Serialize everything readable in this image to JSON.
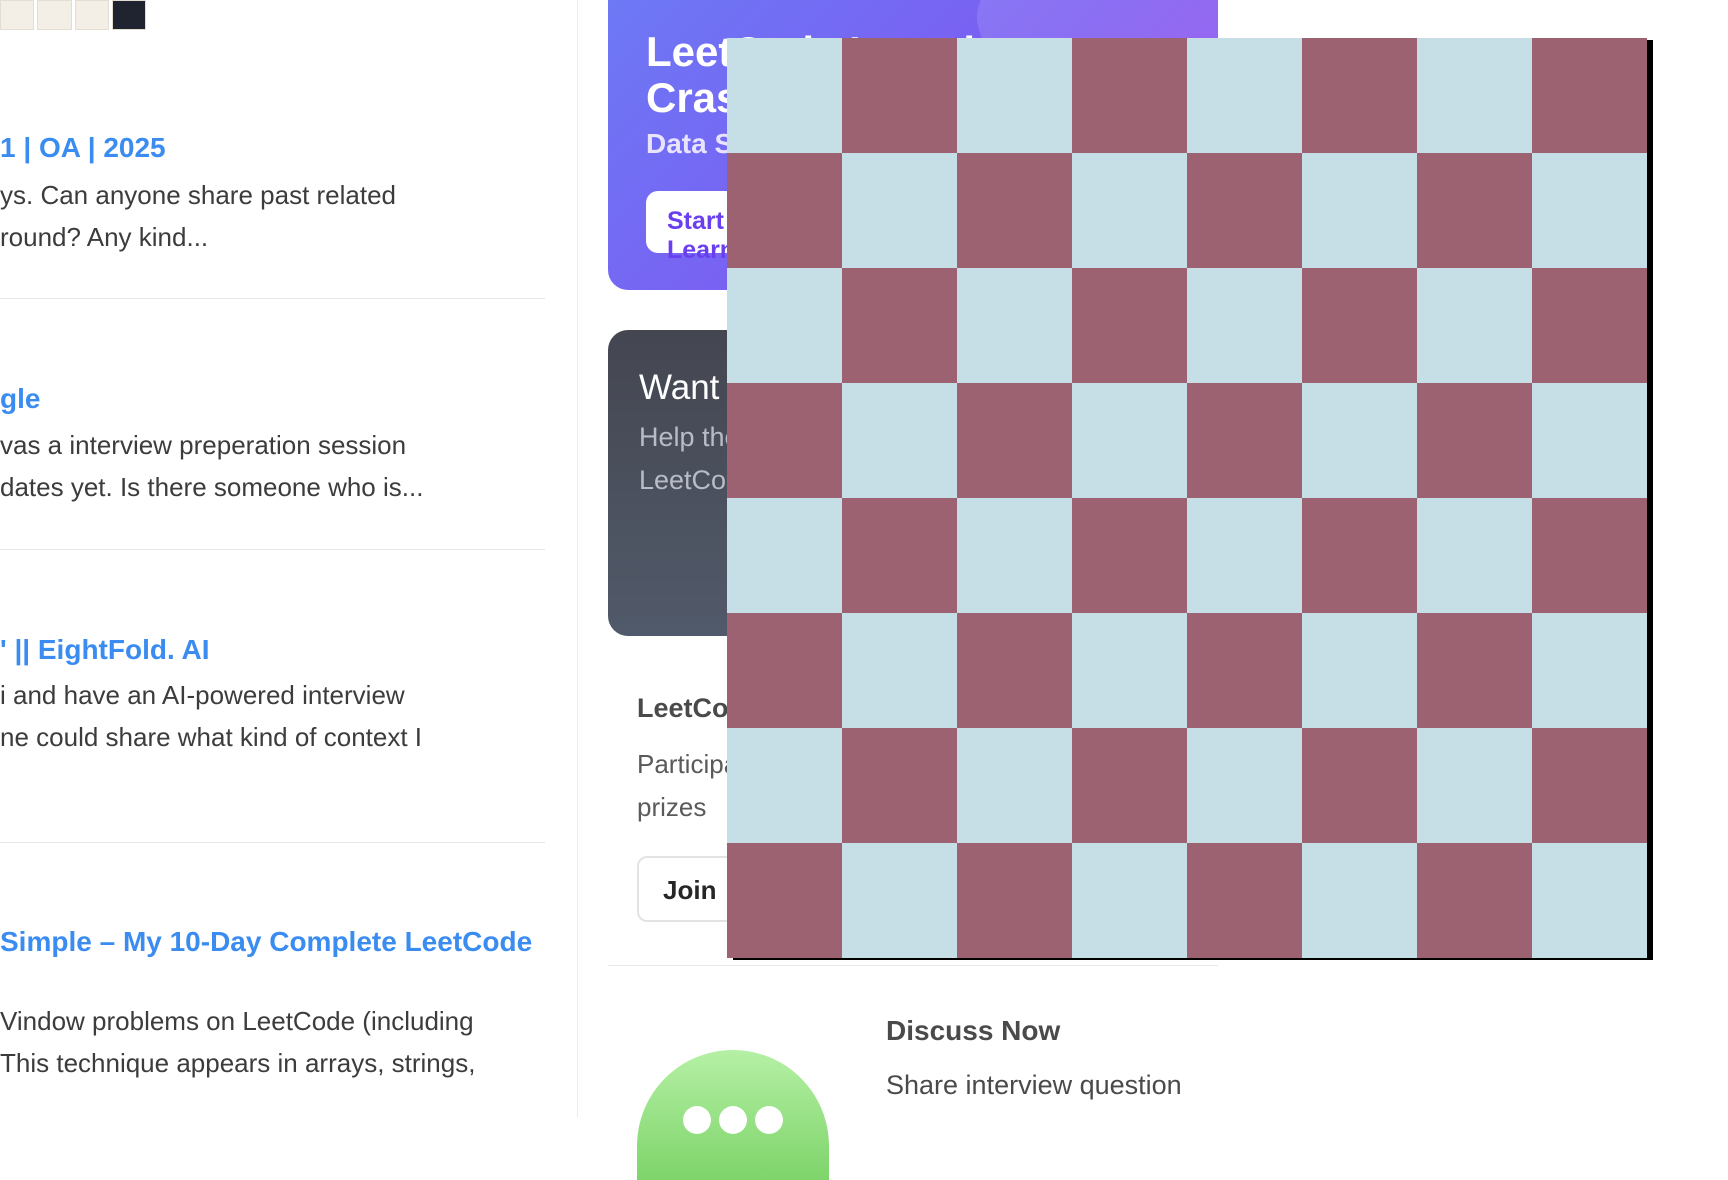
{
  "feed": {
    "posts": [
      {
        "title": "1 | OA | 2025",
        "snippet": [
          "ys. Can anyone share past related",
          " round? Any kind..."
        ]
      },
      {
        "title": "gle",
        "snippet": [
          "vas a interview preperation session",
          "dates yet. Is there someone who is..."
        ]
      },
      {
        "title": "' || EightFold. AI",
        "snippet": [
          "i and have an AI-powered interview",
          "ne could share what kind of context I"
        ]
      },
      {
        "title": " Simple – My 10-Day Complete LeetCode",
        "snippet": [
          "Vindow problems on LeetCode (including",
          " This technique appears in arrays, strings,"
        ]
      }
    ]
  },
  "sidebar": {
    "promo": {
      "line1": "LeetCode Interview",
      "line2": "Crash Course",
      "line3": "Data Structures",
      "button": "Start Learning"
    },
    "contribute": {
      "heading": "Want to Contribute?",
      "text": [
        "Help the community",
        "LeetCode"
      ]
    },
    "contest": {
      "title": "LeetCode Contest",
      "text": [
        "Participate",
        "prizes"
      ],
      "button": "Join"
    },
    "discuss": {
      "title": "Discuss Now",
      "text": "Share interview question"
    }
  },
  "board": {
    "rows": 8,
    "cols": 8,
    "light_color": "#c6dfe6",
    "dark_color": "#9c6272",
    "shadow_color": "#000000"
  },
  "colors": {
    "link_blue": "#3b8cf0",
    "promo_purple": "#7b5cf2"
  }
}
